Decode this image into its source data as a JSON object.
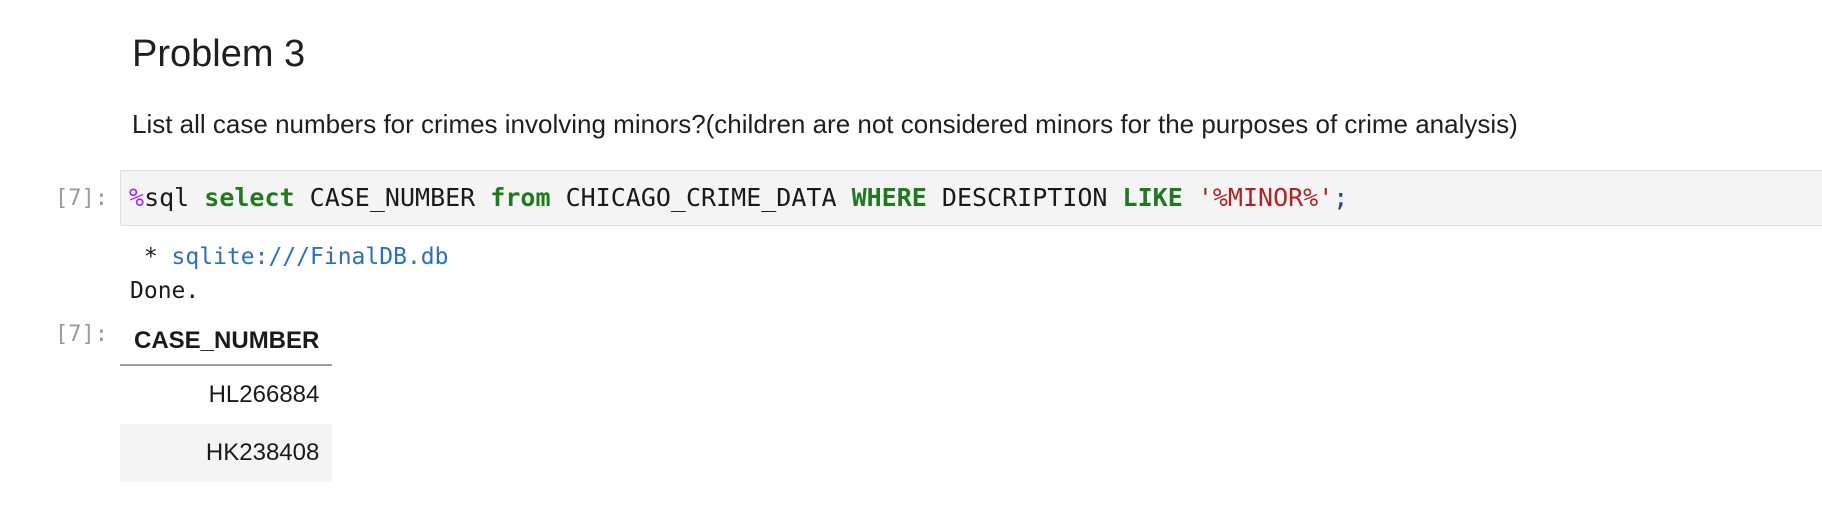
{
  "markdown": {
    "heading": "Problem 3",
    "question": "List all case numbers for crimes involving minors?(children are not considered minors for the purposes of crime analysis)"
  },
  "code_cell": {
    "in_prompt": "[7]:",
    "tokens": {
      "magic_percent": "%",
      "magic_name": "sql",
      "kw_select": "select",
      "column": "CASE_NUMBER",
      "kw_from": "from",
      "table": "CHICAGO_CRIME_DATA",
      "kw_where": "WHERE",
      "field": "DESCRIPTION",
      "kw_like": "LIKE",
      "pattern": "'%MINOR%'",
      "semicolon": ";"
    }
  },
  "stream_output": {
    "bullet": " * ",
    "connection": "sqlite:///FinalDB.db",
    "status": "Done."
  },
  "result": {
    "out_prompt": "[7]:",
    "column_header": "CASE_NUMBER",
    "rows": [
      "HL266884",
      "HK238408"
    ]
  },
  "colors": {
    "keyword": "#1f7a1f",
    "string": "#b22222",
    "magic": "#aa22ff",
    "link": "#2a6fc4",
    "prompt": "#9a9a9a"
  }
}
